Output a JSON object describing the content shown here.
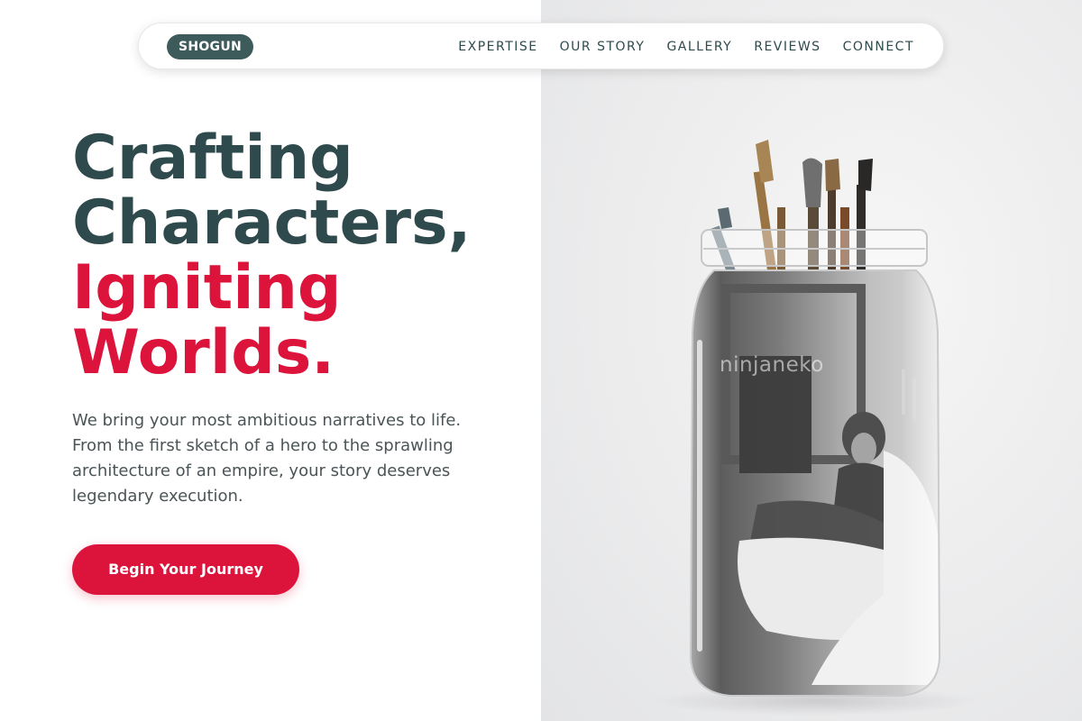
{
  "nav": {
    "logo": "SHOGUN",
    "links": [
      "EXPERTISE",
      "OUR STORY",
      "GALLERY",
      "REVIEWS",
      "CONNECT"
    ]
  },
  "hero": {
    "headline": [
      "Crafting",
      "Characters,",
      "Igniting",
      "Worlds."
    ],
    "body": "We bring your most ambitious narratives to life. From the first sketch of a hero to the sprawling architecture of an empire, your story deserves legendary execution.",
    "cta": "Begin Your Journey",
    "image_watermark": "ninjaneko"
  },
  "colors": {
    "primary": "#2e4a4c",
    "accent": "#dc143c",
    "logo_bg": "#3e5b5c",
    "text_muted": "#4b5456"
  }
}
